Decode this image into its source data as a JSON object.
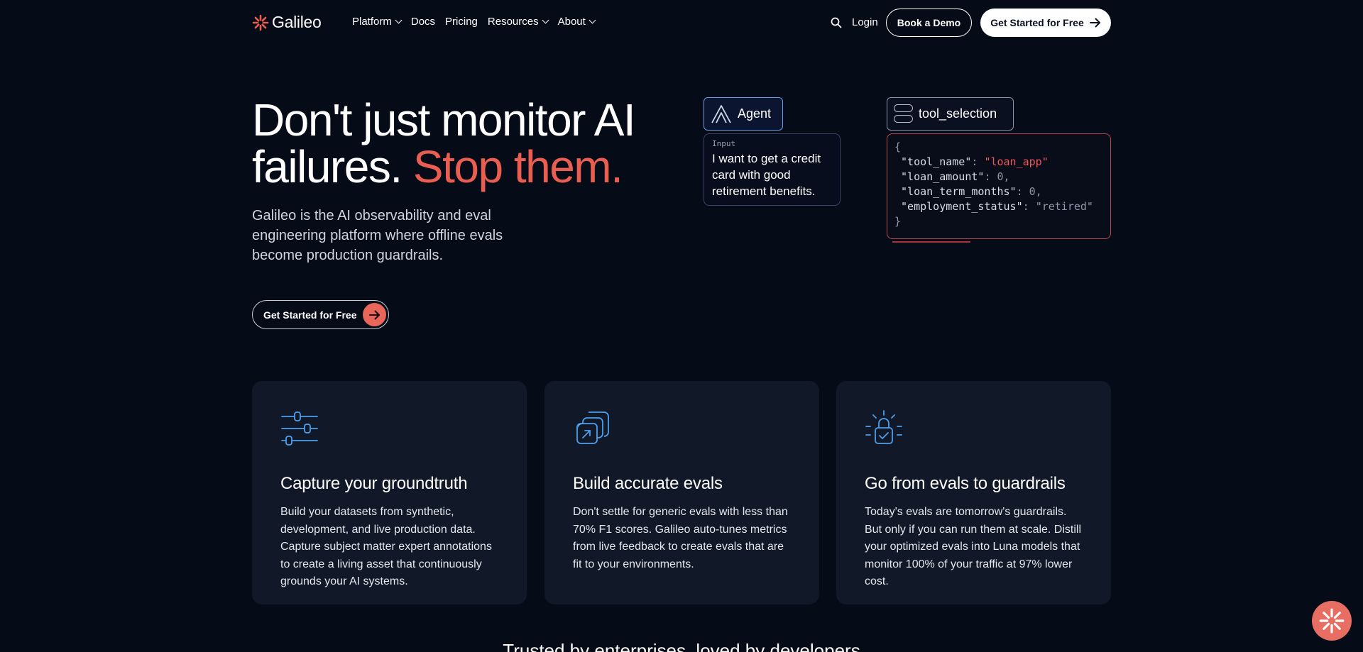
{
  "brand": {
    "name": "Galileo",
    "accent": "#ea5d51"
  },
  "nav": {
    "items": [
      {
        "label": "Platform",
        "dropdown": true
      },
      {
        "label": "Docs",
        "dropdown": false
      },
      {
        "label": "Pricing",
        "dropdown": false
      },
      {
        "label": "Resources",
        "dropdown": true
      },
      {
        "label": "About",
        "dropdown": true
      }
    ],
    "login_label": "Login",
    "demo_label": "Book a Demo",
    "cta_label": "Get Started for Free"
  },
  "hero": {
    "title_line1": "Don't just monitor AI",
    "title_line2": "failures.",
    "title_accent": "Stop them.",
    "subtitle": "Galileo is the AI observability and eval engineering platform where offline evals become production guardrails.",
    "cta_label": "Get Started for Free"
  },
  "diagram": {
    "agent_label": "Agent",
    "input_label": "Input",
    "input_text": "I want to get a credit card with good retirement benefits.",
    "tool_label": "tool_selection",
    "code": {
      "open": "{",
      "close": "}",
      "lines": [
        {
          "key": "\"tool_name\"",
          "value": "\"loan_app\"",
          "highlight": true
        },
        {
          "key": "\"loan_amount\"",
          "value": "0,",
          "highlight": false
        },
        {
          "key": "\"loan_term_months\"",
          "value": "0,",
          "highlight": false
        },
        {
          "key": "\"employment_status\"",
          "value": "\"retired\"",
          "highlight": false
        }
      ]
    }
  },
  "cards": [
    {
      "icon": "sliders-icon",
      "title": "Capture your groundtruth",
      "text": "Build your datasets from synthetic, development, and live production data. Capture subject matter expert annotations to create a living asset that continuously grounds your AI systems."
    },
    {
      "icon": "stacked-cards-icon",
      "title": "Build accurate evals",
      "text": "Don't settle for generic evals with less than 70% F1 scores. Galileo auto-tunes metrics from live feedback to create evals that are fit to your environments."
    },
    {
      "icon": "lock-icon",
      "title": "Go from evals to guardrails",
      "text": "Today's evals are tomorrow's guardrails. But only if you can run them at scale. Distill your optimized evals into Luna models that monitor 100% of your traffic at 97% lower cost."
    }
  ],
  "trusted_heading": "Trusted by enterprises, loved by developers"
}
